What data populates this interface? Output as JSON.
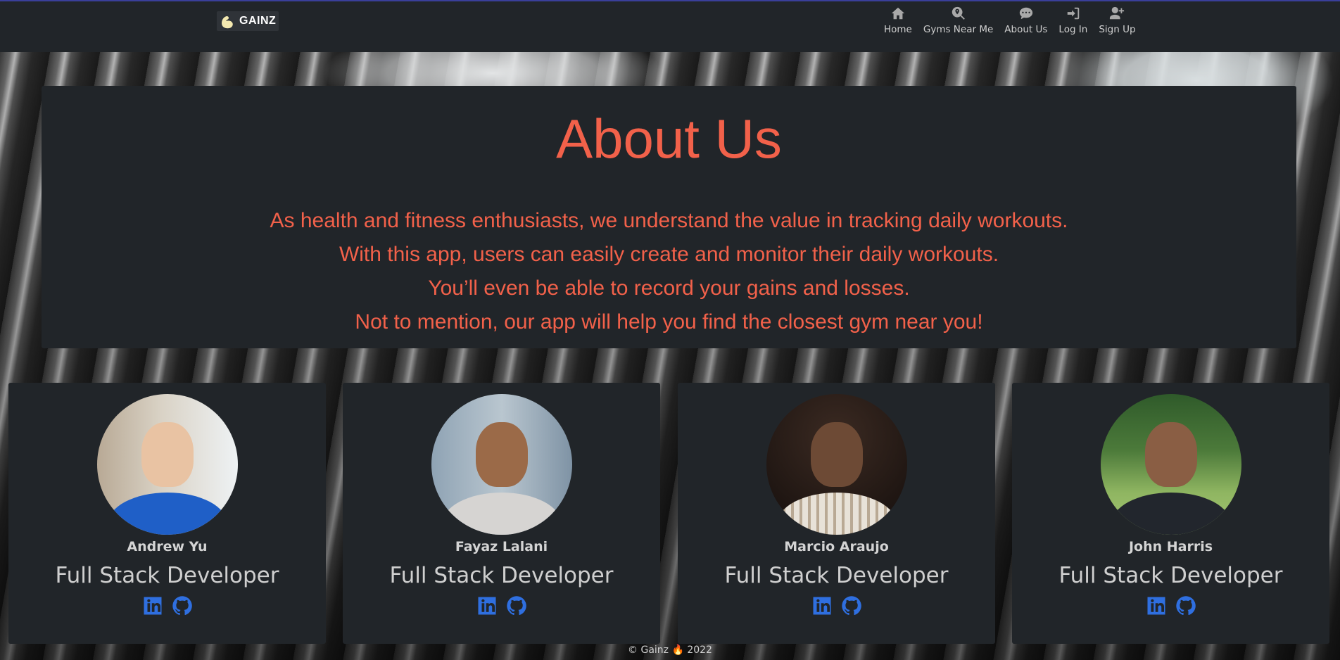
{
  "brand": {
    "name": "GAINZ"
  },
  "nav": {
    "items": [
      {
        "label": "Home",
        "icon": "home-icon"
      },
      {
        "label": "Gyms Near Me",
        "icon": "search-location-icon"
      },
      {
        "label": "About Us",
        "icon": "chat-bubble-icon"
      },
      {
        "label": "Log In",
        "icon": "sign-in-icon"
      },
      {
        "label": "Sign Up",
        "icon": "user-plus-icon"
      }
    ]
  },
  "about": {
    "title": "About Us",
    "lines": [
      "As health and fitness enthusiasts, we understand the value in tracking daily workouts.",
      "With this app, users can easily create and monitor their daily workouts.",
      "You’ll even be able to record your gains and losses.",
      "Not to mention, our app will help you find the closest gym near you!"
    ]
  },
  "team": [
    {
      "name": "Andrew Yu",
      "role": "Full Stack Developer"
    },
    {
      "name": "Fayaz Lalani",
      "role": "Full Stack Developer"
    },
    {
      "name": "Marcio Araujo",
      "role": "Full Stack Developer"
    },
    {
      "name": "John Harris",
      "role": "Full Stack Developer"
    }
  ],
  "footer": {
    "text": "© Gainz 🔥 2022"
  },
  "colors": {
    "accent": "#f2614a",
    "card_bg": "#212529",
    "social_blue": "#2f6fe0"
  }
}
